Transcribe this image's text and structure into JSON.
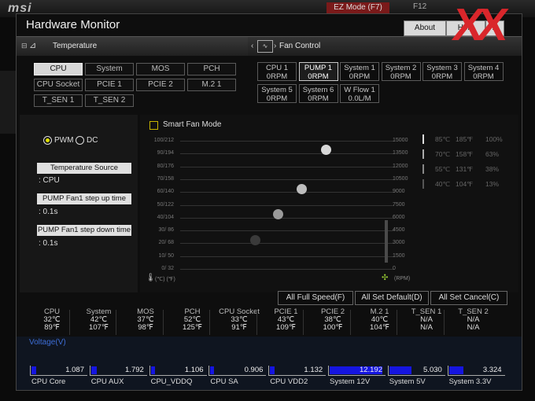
{
  "background": {
    "logo": "msi",
    "ez_mode": "EZ Mode (F7)",
    "f12": "F12",
    "watermark": "XX"
  },
  "window": {
    "title": "Hardware Monitor",
    "about": "About",
    "help": "Help",
    "close": "X"
  },
  "temperature_header": "Temperature",
  "fan_control_header": "Fan Control",
  "temp_sources": [
    "CPU",
    "System",
    "MOS",
    "PCH",
    "CPU Socket",
    "PCIE 1",
    "PCIE 2",
    "M.2 1",
    "T_SEN 1",
    "T_SEN 2"
  ],
  "selected_temp_source": "CPU",
  "fans": [
    {
      "name": "CPU 1",
      "rpm": "0RPM"
    },
    {
      "name": "PUMP 1",
      "rpm": "0RPM"
    },
    {
      "name": "System 1",
      "rpm": "0RPM"
    },
    {
      "name": "System 2",
      "rpm": "0RPM"
    },
    {
      "name": "System 3",
      "rpm": "0RPM"
    },
    {
      "name": "System 4",
      "rpm": "0RPM"
    },
    {
      "name": "System 5",
      "rpm": "0RPM"
    },
    {
      "name": "System 6",
      "rpm": "0RPM"
    },
    {
      "name": "W Flow 1",
      "rpm": "0.0L/M"
    }
  ],
  "selected_fan": "PUMP 1",
  "control": {
    "pwm": "PWM",
    "dc": "DC",
    "mode": "PWM",
    "temp_source_label": "Temperature Source",
    "temp_source_value": ": CPU",
    "step_up_label": "PUMP Fan1 step up time",
    "step_up_value": ": 0.1s",
    "step_down_label": "PUMP Fan1 step down time",
    "step_down_value": ": 0.1s"
  },
  "graph": {
    "smart_fan_mode": "Smart Fan Mode",
    "y_left": [
      "100/212",
      "90/194",
      "80/176",
      "70/158",
      "60/140",
      "50/122",
      "40/104",
      "30/ 86",
      "20/ 68",
      "10/ 50",
      "0/ 32"
    ],
    "y_right": [
      "15000",
      "13500",
      "12000",
      "10500",
      "9000",
      "7500",
      "6000",
      "4500",
      "3000",
      "1500",
      "0"
    ],
    "unit_temp": "(℃)   (℉)",
    "unit_rpm": "(RPM)",
    "legend": [
      {
        "c": "85℃",
        "f": "185℉",
        "pct": "100%"
      },
      {
        "c": "70℃",
        "f": "158℉",
        "pct": "63%"
      },
      {
        "c": "55℃",
        "f": "131℉",
        "pct": "38%"
      },
      {
        "c": "40℃",
        "f": "104℉",
        "pct": "13%"
      }
    ]
  },
  "buttons": {
    "full_speed": "All Full Speed(F)",
    "set_default": "All Set Default(D)",
    "set_cancel": "All Set Cancel(C)"
  },
  "readouts": [
    {
      "name": "CPU",
      "c": "32℃",
      "f": "89℉"
    },
    {
      "name": "System",
      "c": "42℃",
      "f": "107℉"
    },
    {
      "name": "MOS",
      "c": "37℃",
      "f": "98℉"
    },
    {
      "name": "PCH",
      "c": "52℃",
      "f": "125℉"
    },
    {
      "name": "CPU Socket",
      "c": "33℃",
      "f": "91℉"
    },
    {
      "name": "PCIE 1",
      "c": "43℃",
      "f": "109℉"
    },
    {
      "name": "PCIE 2",
      "c": "38℃",
      "f": "100℉"
    },
    {
      "name": "M.2 1",
      "c": "40℃",
      "f": "104℉"
    },
    {
      "name": "T_SEN 1",
      "c": "N/A",
      "f": "N/A"
    },
    {
      "name": "T_SEN 2",
      "c": "N/A",
      "f": "N/A"
    }
  ],
  "voltage_title": "Voltage(V)",
  "voltages": [
    {
      "name": "CPU Core",
      "value": "1.087",
      "fill": 0.08
    },
    {
      "name": "CPU AUX",
      "value": "1.792",
      "fill": 0.1
    },
    {
      "name": "CPU_VDDQ",
      "value": "1.106",
      "fill": 0.08
    },
    {
      "name": "CPU SA",
      "value": "0.906",
      "fill": 0.06
    },
    {
      "name": "CPU VDD2",
      "value": "1.132",
      "fill": 0.08
    },
    {
      "name": "System 12V",
      "value": "12.192",
      "fill": 0.95
    },
    {
      "name": "System 5V",
      "value": "5.030",
      "fill": 0.4
    },
    {
      "name": "System 3.3V",
      "value": "3.324",
      "fill": 0.26
    }
  ],
  "accent_color": "#e0e000",
  "voltage_color": "#1515e0"
}
